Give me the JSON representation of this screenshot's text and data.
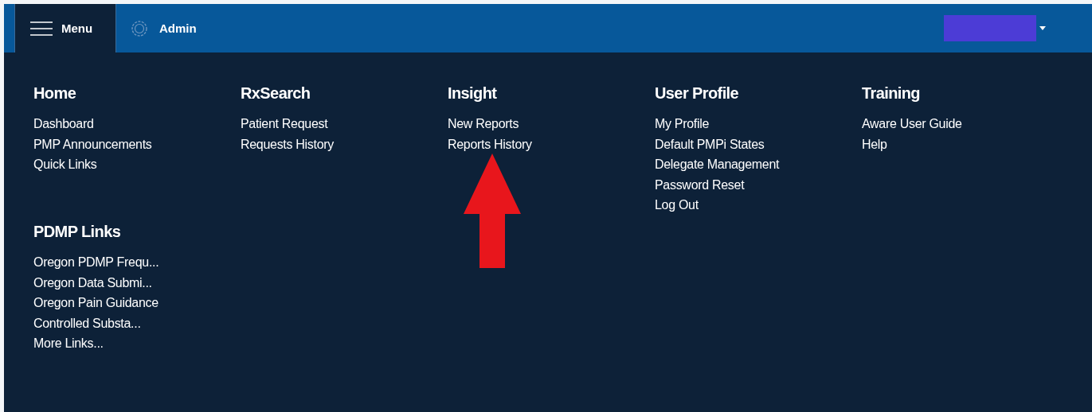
{
  "top_bar": {
    "menu_button": "Menu",
    "admin_link": "Admin"
  },
  "sections": [
    {
      "title": "Home",
      "links": [
        "Dashboard",
        "PMP Announcements",
        "Quick Links"
      ]
    },
    {
      "title": "RxSearch",
      "links": [
        "Patient Request",
        "Requests History"
      ]
    },
    {
      "title": "Insight",
      "links": [
        "New Reports",
        "Reports History"
      ]
    },
    {
      "title": "User Profile",
      "links": [
        "My Profile",
        "Default PMPi States",
        "Delegate Management",
        "Password Reset",
        "Log Out"
      ]
    },
    {
      "title": "Training",
      "links": [
        "Aware User Guide",
        "Help"
      ]
    }
  ],
  "pdmp_links": {
    "title": "PDMP Links",
    "links": [
      "Oregon PDMP Frequ...",
      "Oregon Data Submi...",
      "Oregon Pain Guidance",
      "Controlled Substa...",
      "More Links..."
    ]
  }
}
